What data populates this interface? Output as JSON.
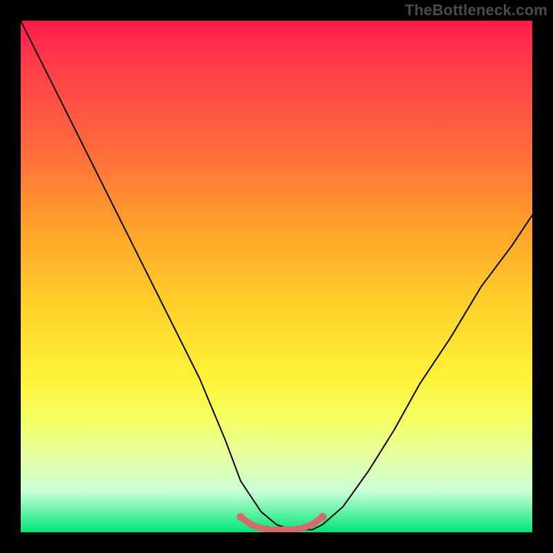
{
  "watermark": "TheBottleneck.com",
  "chart_data": {
    "type": "line",
    "title": "",
    "xlabel": "",
    "ylabel": "",
    "xlim": [
      0,
      100
    ],
    "ylim": [
      0,
      100
    ],
    "grid": false,
    "legend": false,
    "background_gradient": {
      "stops": [
        {
          "pos": 0,
          "color": "#ff1a4d"
        },
        {
          "pos": 25,
          "color": "#ff6a3d"
        },
        {
          "pos": 55,
          "color": "#ffcf2a"
        },
        {
          "pos": 78,
          "color": "#f4ff63"
        },
        {
          "pos": 100,
          "color": "#00e676"
        }
      ]
    },
    "series": [
      {
        "name": "bottleneck-curve",
        "color": "#000000",
        "width": 1.5,
        "x": [
          0,
          5,
          10,
          15,
          20,
          25,
          30,
          35,
          40,
          43,
          47,
          50,
          53,
          57,
          59,
          63,
          68,
          73,
          78,
          84,
          90,
          96,
          100
        ],
        "y": [
          100,
          90,
          80,
          70,
          60,
          50,
          40,
          30,
          18,
          10,
          4,
          1.5,
          0.5,
          0.5,
          1.5,
          5,
          12,
          20,
          29,
          38,
          48,
          56,
          62
        ]
      },
      {
        "name": "optimal-zone-marker",
        "color": "#d46a6a",
        "width": 7,
        "x": [
          43,
          45,
          47,
          49,
          51,
          53,
          55,
          57,
          59
        ],
        "y": [
          3.0,
          1.5,
          0.8,
          0.5,
          0.5,
          0.5,
          0.8,
          1.5,
          3.0
        ]
      }
    ],
    "annotations": []
  }
}
